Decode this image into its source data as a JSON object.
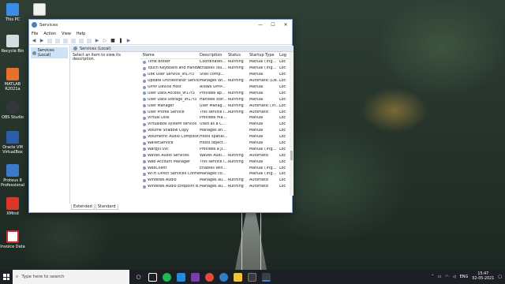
{
  "desktop": {
    "icons": [
      {
        "label": "This PC",
        "color": "#3a8ee6"
      },
      {
        "label": "Recycle Bin",
        "color": "#d5dbe3"
      },
      {
        "label": "MATLAB R2021a",
        "color": "#e8712a"
      },
      {
        "label": "OBS Studio",
        "color": "#333840"
      },
      {
        "label": "Oracle VM VirtualBox",
        "color": "#2c5ea8"
      },
      {
        "label": "Proteus 8 Professional",
        "color": "#3c78c8"
      },
      {
        "label": "XMind",
        "color": "#d9372a"
      },
      {
        "label": "Invoice Data",
        "color": "#c9302c"
      }
    ],
    "folder_icon": "folder-icon"
  },
  "window": {
    "title": "Services",
    "minimize": "—",
    "maximize": "☐",
    "close": "✕",
    "menu": [
      "File",
      "Action",
      "View",
      "Help"
    ],
    "left_pane_item": "Services (Local)",
    "pane_header": "Services (Local)",
    "description_prompt": "Select an item to view its description.",
    "columns": {
      "name": "Name",
      "description": "Description",
      "status": "Status",
      "startup": "Startup Type",
      "logon": "Log"
    },
    "rows": [
      {
        "name": "Time Broker",
        "description": "Coordinates...",
        "status": "Running",
        "startup": "Manual (Trig...",
        "logon": "Loc"
      },
      {
        "name": "Touch Keyboard and Handw...",
        "description": "Enables Tou...",
        "status": "Running",
        "startup": "Manual (Trig...",
        "logon": "Loc"
      },
      {
        "name": "Udk User Service_9f17f3",
        "description": "Shell comp...",
        "status": "",
        "startup": "Manual",
        "logon": "Loc"
      },
      {
        "name": "Update Orchestrator Service",
        "description": "Manages Wi...",
        "status": "Running",
        "startup": "Automatic (De...",
        "logon": "Loc"
      },
      {
        "name": "UPnP Device Host",
        "description": "Allows UPnP...",
        "status": "",
        "startup": "Manual",
        "logon": "Loc"
      },
      {
        "name": "User Data Access_9f17f3",
        "description": "Provides ap...",
        "status": "Running",
        "startup": "Manual",
        "logon": "Loc"
      },
      {
        "name": "User Data Storage_9f17f3",
        "description": "Handles stor...",
        "status": "Running",
        "startup": "Manual",
        "logon": "Loc"
      },
      {
        "name": "User Manager",
        "description": "User Manag...",
        "status": "Running",
        "startup": "Automatic (Tri...",
        "logon": "Loc"
      },
      {
        "name": "User Profile Service",
        "description": "This service i...",
        "status": "Running",
        "startup": "Automatic",
        "logon": "Loc"
      },
      {
        "name": "Virtual Disk",
        "description": "Provides ma...",
        "status": "",
        "startup": "Manual",
        "logon": "Loc"
      },
      {
        "name": "VirtualBox system service",
        "description": "Used as a C...",
        "status": "",
        "startup": "Manual",
        "logon": "Loc"
      },
      {
        "name": "Volume Shadow Copy",
        "description": "Manages an...",
        "status": "",
        "startup": "Manual",
        "logon": "Loc"
      },
      {
        "name": "Volumetric Audio Composit...",
        "description": "Hosts spatial...",
        "status": "",
        "startup": "Manual",
        "logon": "Loc"
      },
      {
        "name": "WalletService",
        "description": "Hosts object...",
        "status": "",
        "startup": "Manual",
        "logon": "Loc"
      },
      {
        "name": "WarpJITSvc",
        "description": "Provides a JI...",
        "status": "",
        "startup": "Manual (Trig...",
        "logon": "Loc"
      },
      {
        "name": "Waves Audio Services",
        "description": "Waves Audi...",
        "status": "Running",
        "startup": "Automatic",
        "logon": "Loc"
      },
      {
        "name": "Web Account Manager",
        "description": "This service i...",
        "status": "Running",
        "startup": "Manual",
        "logon": "Loc"
      },
      {
        "name": "WebClient",
        "description": "Enables Win...",
        "status": "",
        "startup": "Manual (Trig...",
        "logon": "Loc"
      },
      {
        "name": "Wi-Fi Direct Services Conne...",
        "description": "Manages co...",
        "status": "",
        "startup": "Manual (Trig...",
        "logon": "Loc"
      },
      {
        "name": "Windows Audio",
        "description": "Manages au...",
        "status": "Running",
        "startup": "Automatic",
        "logon": "Loc"
      },
      {
        "name": "Windows Audio Endpoint B...",
        "description": "Manages au...",
        "status": "Running",
        "startup": "Automatic",
        "logon": "Loc"
      }
    ],
    "tabs": [
      "Extended",
      "Standard"
    ]
  },
  "taskbar": {
    "search_placeholder": "Type here to search",
    "language": "ENG",
    "time": "15:47",
    "date": "02-05-2021",
    "accent_color": "#2a88d8"
  }
}
